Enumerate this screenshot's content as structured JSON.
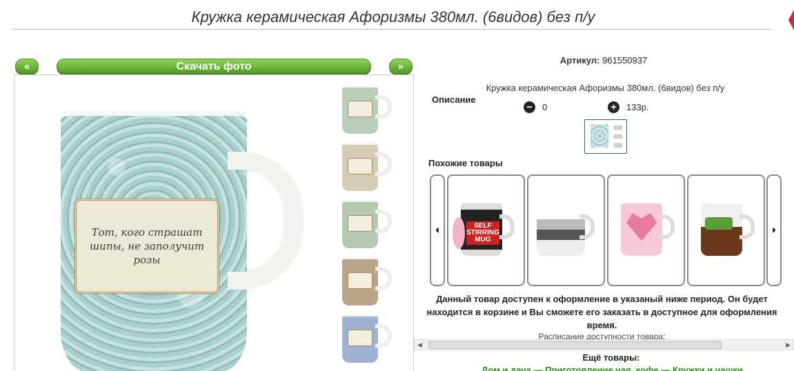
{
  "page": {
    "title": "Кружка керамическая Афоризмы 380мл. (6видов) без п/у"
  },
  "gallery": {
    "prev_label": "«",
    "download_label": "Скачать фото",
    "next_label": "»",
    "main_image": {
      "label_text": "Тот, кого страшат шипы, не заполучит розы"
    },
    "thumbnail_colors": [
      "#b9cdb9",
      "#d6cbb7",
      "#b5c9b0",
      "#bba58a",
      "#9fb2d1"
    ]
  },
  "product": {
    "sku_label": "Артикул:",
    "sku_value": "961550937",
    "name": "Кружка керамическая Афоризмы 380мл. (6видов) без п/у",
    "description_label": "Описание",
    "qty_minus_icon": "−",
    "qty_value": "0",
    "qty_plus_icon": "+",
    "price": "133р."
  },
  "similar": {
    "title": "Похожие товары",
    "prev_arrow": "⏴",
    "next_arrow": "⏵",
    "items": [
      {
        "label": "SELF STIRRING MUG"
      },
      {
        "label": ""
      },
      {
        "label": ""
      },
      {
        "label": ""
      }
    ]
  },
  "availability": {
    "text": "Данный товар доступен к оформление в указаный ниже период. Он будет находится в корзине и Вы сможете его заказать в доступное для оформления время.",
    "schedule_label": "Расписание доступности товара:"
  },
  "more": {
    "title": "Ещё товары:",
    "links_text": "Дом и дача — Приготовление чая, кофе — Кружки и чашки"
  }
}
